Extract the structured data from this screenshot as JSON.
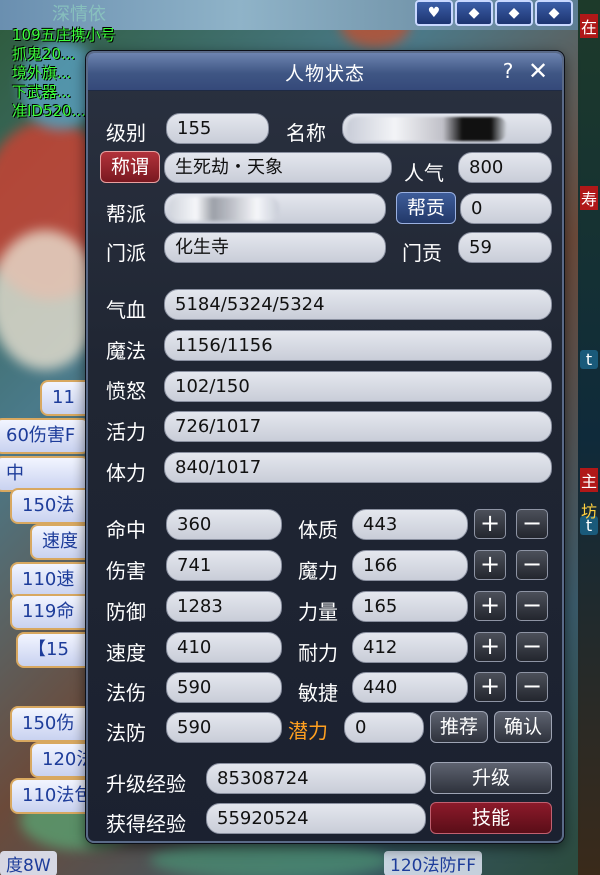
{
  "background": {
    "top_left_lines": [
      "109五庄携小号",
      "抓鬼20...",
      "境外旗...",
      "下武器...",
      "准ID520..."
    ],
    "top_icons": [
      "heart-icon",
      "gem-icon",
      "gem-icon",
      "gem-icon"
    ],
    "left_items": [
      "11",
      "60伤害F",
      "中",
      "150法",
      "速度",
      "110速",
      "119命",
      "【15",
      "150伤",
      "120法",
      "110法包"
    ],
    "bottom_left": "度8W",
    "bottom_right": "120法防FF",
    "right_glyphs": [
      "在",
      "寿",
      "t",
      "t",
      "主",
      "坊"
    ]
  },
  "window": {
    "title": "人物状态",
    "help_label": "?",
    "close_label": "✕"
  },
  "info": {
    "level_label": "级别",
    "level_value": "155",
    "name_label": "名称",
    "name_value": "",
    "title_button": "称谓",
    "title_value": "生死劫・天象",
    "popularity_label": "人气",
    "popularity_value": "800",
    "gang_label": "帮派",
    "gang_value": "",
    "contribution_button": "帮贡",
    "contribution_value": "0",
    "sect_label": "门派",
    "sect_value": "化生寺",
    "sect_contribution_label": "门贡",
    "sect_contribution_value": "59"
  },
  "vitals": [
    {
      "label": "气血",
      "value": "5184/5324/5324"
    },
    {
      "label": "魔法",
      "value": "1156/1156"
    },
    {
      "label": "愤怒",
      "value": "102/150"
    },
    {
      "label": "活力",
      "value": "726/1017"
    },
    {
      "label": "体力",
      "value": "840/1017"
    }
  ],
  "stats": [
    {
      "label": "命中",
      "value": "360",
      "attr_label": "体质",
      "attr_value": "443"
    },
    {
      "label": "伤害",
      "value": "741",
      "attr_label": "魔力",
      "attr_value": "166"
    },
    {
      "label": "防御",
      "value": "1283",
      "attr_label": "力量",
      "attr_value": "165"
    },
    {
      "label": "速度",
      "value": "410",
      "attr_label": "耐力",
      "attr_value": "412"
    },
    {
      "label": "法伤",
      "value": "590",
      "attr_label": "敏捷",
      "attr_value": "440"
    }
  ],
  "potential": {
    "magic_def_label": "法防",
    "magic_def_value": "590",
    "potential_label": "潜力",
    "potential_value": "0",
    "recommend_button": "推荐",
    "confirm_button": "确认"
  },
  "experience": {
    "upgrade_exp_label": "升级经验",
    "upgrade_exp_value": "85308724",
    "upgrade_button": "升级",
    "gained_exp_label": "获得经验",
    "gained_exp_value": "55920524",
    "skills_button": "技能"
  },
  "plus_label": "+",
  "minus_label": "−",
  "colors": {
    "panel_bg": "#202633",
    "titlebar": "#3f5684",
    "field_bg": "#d6d9e2",
    "potential_orange": "#ffa020",
    "title_button_red": "#8c1a2a",
    "contribution_button_blue": "#2f4a80"
  }
}
